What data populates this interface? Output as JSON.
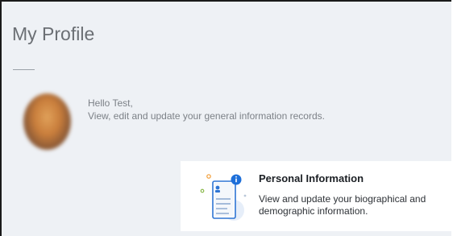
{
  "page": {
    "title": "My Profile"
  },
  "greeting": {
    "hello": "Hello Test,",
    "subtitle": "View, edit and update your general information records."
  },
  "cards": [
    {
      "title": "Personal Information",
      "description": "View and update your biographical and demographic information.",
      "icon": "personal-info-document-icon"
    }
  ],
  "colors": {
    "background": "#eef1f5",
    "card": "#ffffff",
    "accent": "#1e6fd9",
    "title": "#6b6f74"
  }
}
